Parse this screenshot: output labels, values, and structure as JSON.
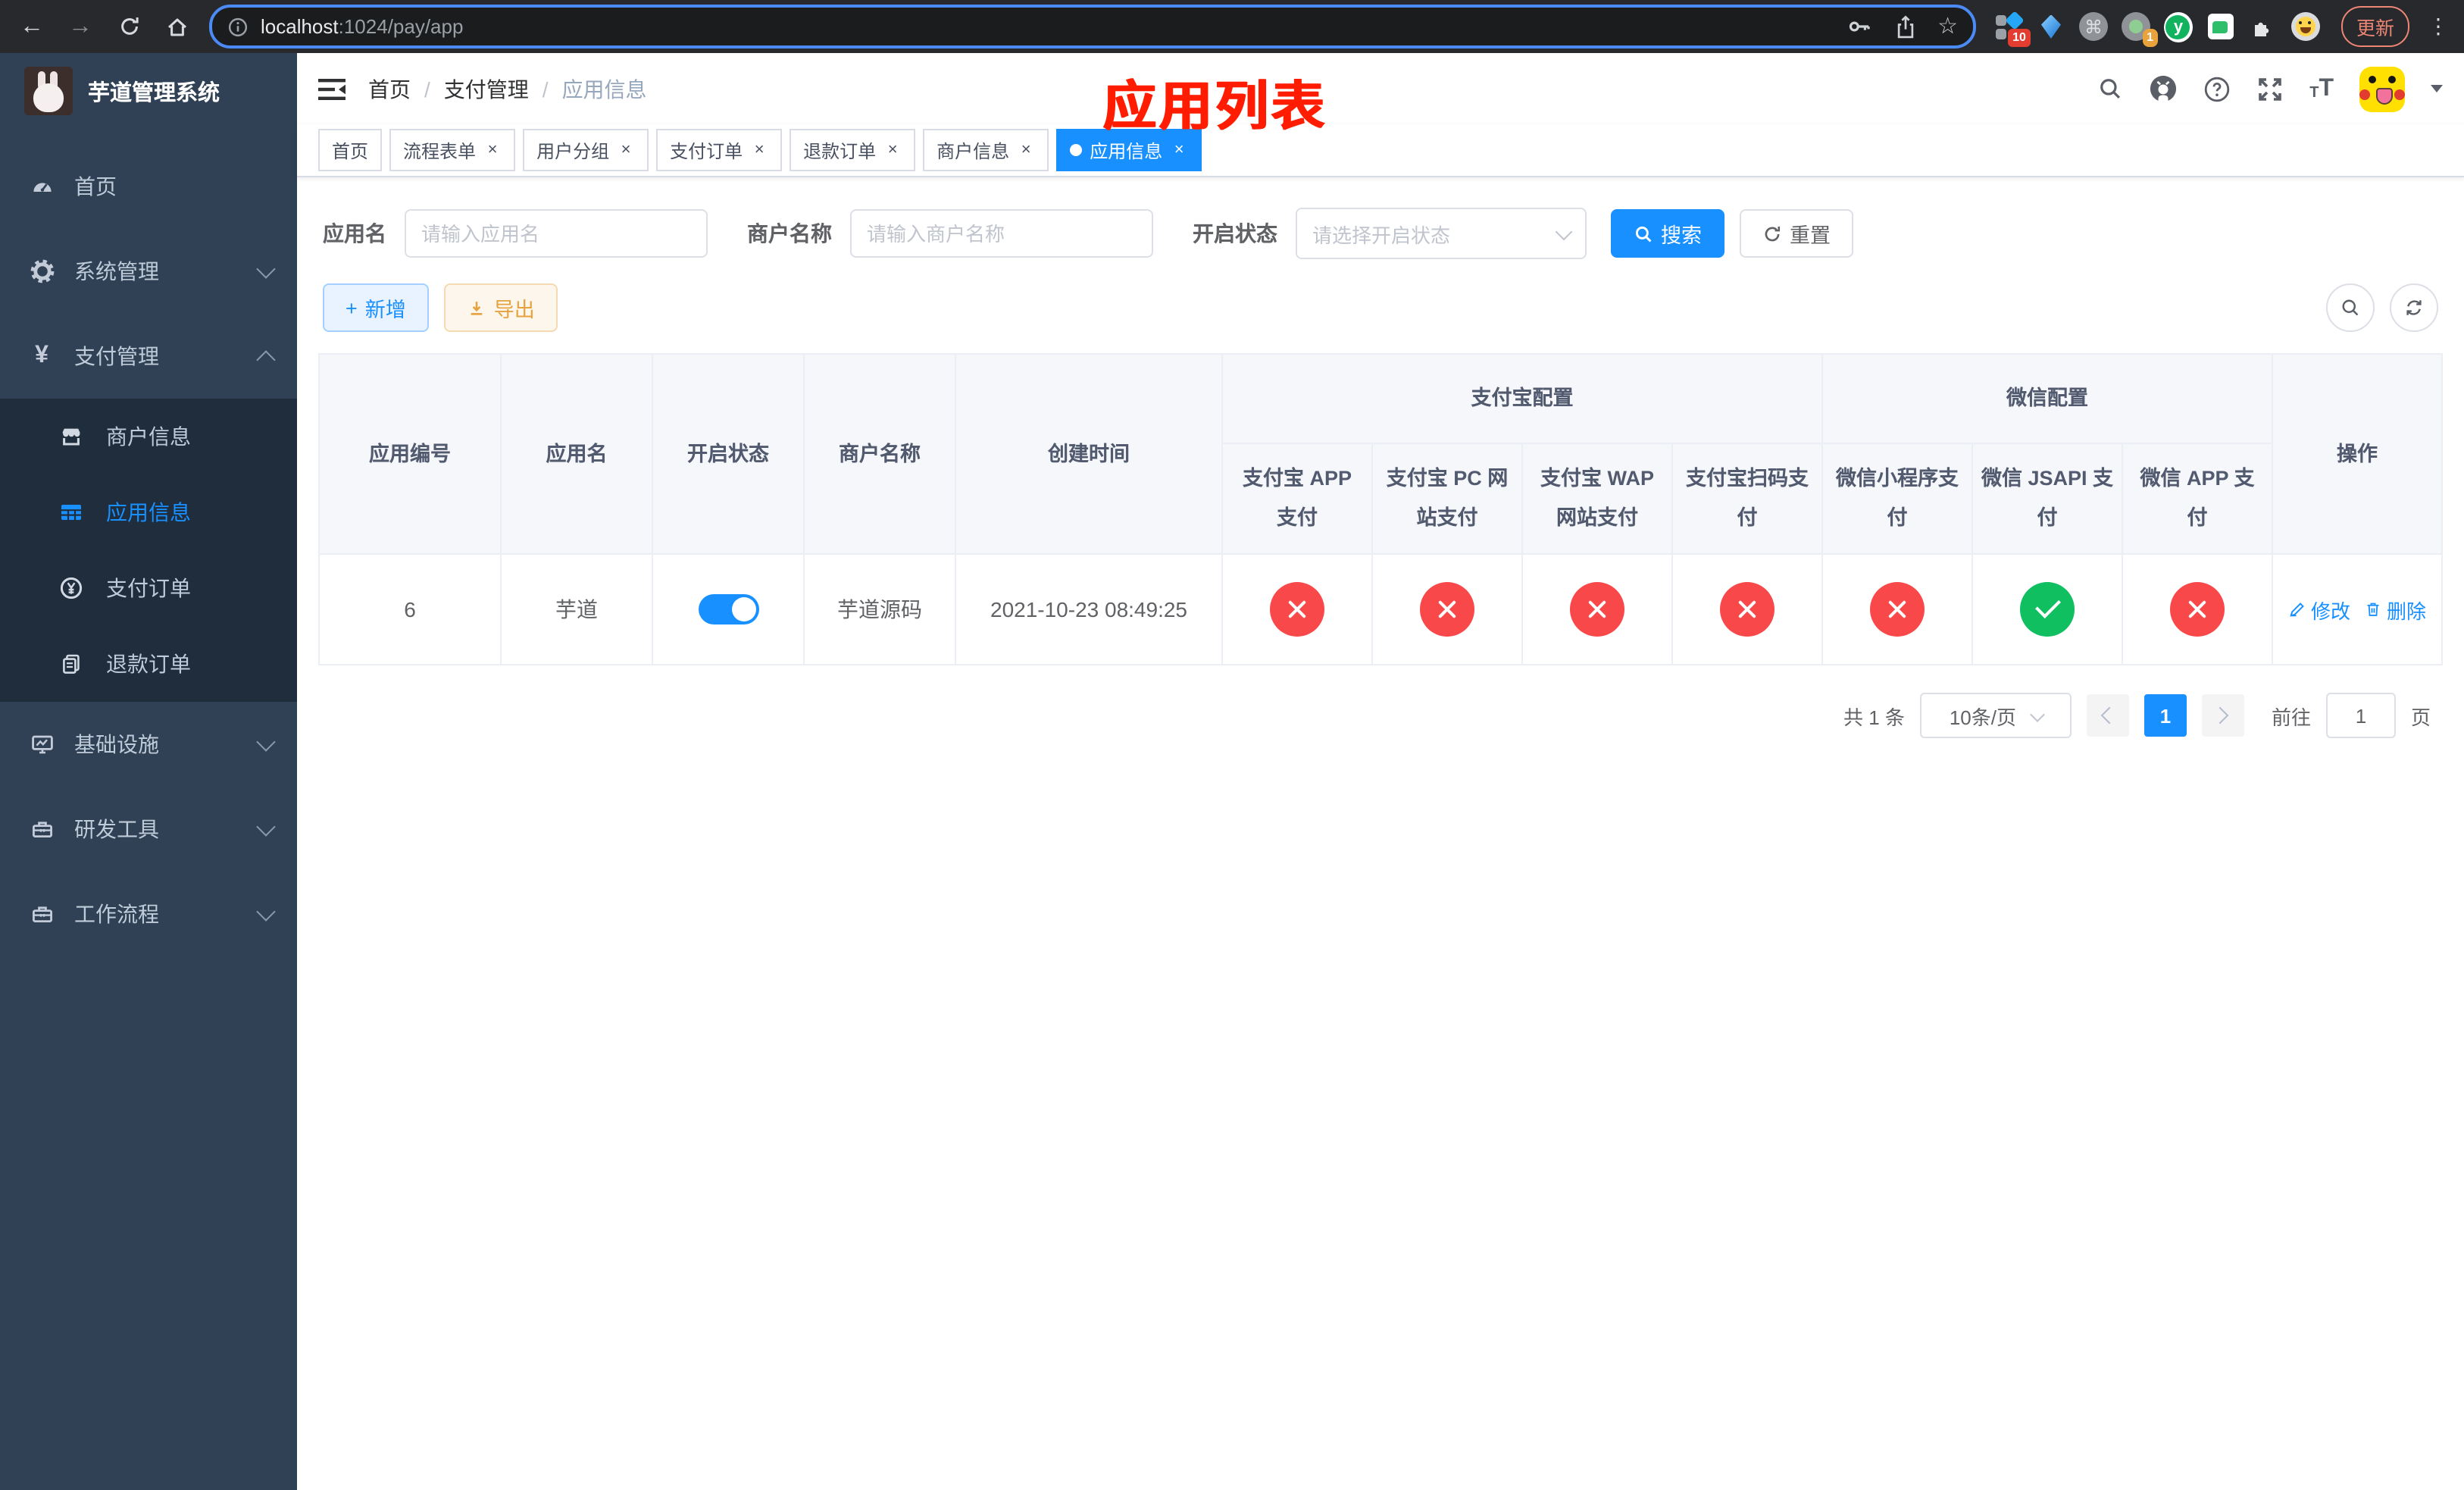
{
  "browser": {
    "url_host": "localhost",
    "url_path": ":1024/pay/app",
    "ext1_badge": "10",
    "ext4_badge": "1",
    "ext5_letter": "y",
    "update_label": "更新"
  },
  "sidebar": {
    "title": "芋道管理系统",
    "menu": [
      {
        "label": "首页"
      },
      {
        "label": "系统管理"
      },
      {
        "label": "支付管理"
      },
      {
        "label": "基础设施"
      },
      {
        "label": "研发工具"
      },
      {
        "label": "工作流程"
      }
    ],
    "submenu": [
      {
        "label": "商户信息"
      },
      {
        "label": "应用信息"
      },
      {
        "label": "支付订单"
      },
      {
        "label": "退款订单"
      }
    ]
  },
  "navbar": {
    "breadcrumb": [
      "首页",
      "支付管理",
      "应用信息"
    ]
  },
  "annotation": {
    "text": "应用列表"
  },
  "tabs": [
    {
      "label": "首页"
    },
    {
      "label": "流程表单"
    },
    {
      "label": "用户分组"
    },
    {
      "label": "支付订单"
    },
    {
      "label": "退款订单"
    },
    {
      "label": "商户信息"
    },
    {
      "label": "应用信息"
    }
  ],
  "filters": {
    "app_name_label": "应用名",
    "app_name_placeholder": "请输入应用名",
    "merchant_label": "商户名称",
    "merchant_placeholder": "请输入商户名称",
    "status_label": "开启状态",
    "status_placeholder": "请选择开启状态",
    "search_label": "搜索",
    "reset_label": "重置"
  },
  "toolbar": {
    "add_label": "新增",
    "export_label": "导出"
  },
  "table": {
    "group_alipay": "支付宝配置",
    "group_wechat": "微信配置",
    "headers": {
      "id": "应用编号",
      "name": "应用名",
      "status": "开启状态",
      "merchant": "商户名称",
      "created": "创建时间",
      "alipay_app": "支付宝 APP 支付",
      "alipay_pc": "支付宝 PC 网站支付",
      "alipay_wap": "支付宝 WAP 网站支付",
      "alipay_qr": "支付宝扫码支付",
      "wx_lite": "微信小程序支付",
      "wx_jsapi": "微信 JSAPI 支付",
      "wx_app": "微信 APP 支付",
      "actions": "操作"
    },
    "row": {
      "id": "6",
      "name": "芋道",
      "switch_state": "on",
      "merchant": "芋道源码",
      "created": "2021-10-23 08:49:25",
      "alipay_app": "no",
      "alipay_pc": "no",
      "alipay_wap": "no",
      "alipay_qr": "no",
      "wx_lite": "no",
      "wx_jsapi": "yes",
      "wx_app": "no",
      "edit_label": "修改",
      "delete_label": "删除"
    }
  },
  "pagination": {
    "total": "共 1 条",
    "page_size": "10条/页",
    "page": "1",
    "goto_label": "前往",
    "goto_value": "1",
    "unit_label": "页"
  },
  "colors": {
    "theme": "#1890ff",
    "danger_circle": "#f8484a",
    "success_circle": "#0fbf60",
    "annotation": "#ff1c00",
    "sidebar_bg": "#304156",
    "submenu_bg": "#1f2d3d"
  }
}
